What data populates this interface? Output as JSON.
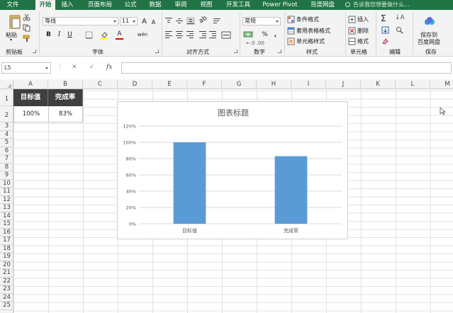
{
  "ribbon": {
    "tabs": [
      "文件",
      "开始",
      "插入",
      "页面布局",
      "公式",
      "数据",
      "审阅",
      "视图",
      "开发工具",
      "Power Pivot",
      "百度网盘"
    ],
    "active_tab": "开始",
    "tell_me": "告诉我您想要做什么...",
    "clipboard": {
      "paste": "粘贴",
      "label": "剪贴板"
    },
    "font": {
      "name": "等线",
      "size": "11",
      "bold": "B",
      "italic": "I",
      "underline": "U",
      "grow": "A",
      "shrink": "A",
      "font_color": "A",
      "phonetic": "wén",
      "label": "字体"
    },
    "alignment": {
      "label": "对齐方式"
    },
    "number": {
      "format": "常规",
      "percent": "%",
      "comma": ",",
      "label": "数字"
    },
    "styles": {
      "conditional": "条件格式",
      "table": "套用表格格式",
      "cell": "单元格样式",
      "label": "样式"
    },
    "cells": {
      "insert": "插入",
      "delete": "删除",
      "format": "格式",
      "label": "单元格"
    },
    "editing": {
      "label": "编辑"
    },
    "save": {
      "button": "保存到百度网盘",
      "line1": "保存到",
      "line2": "百度网盘",
      "label": "保存"
    }
  },
  "formula_bar": {
    "name_box": "L5",
    "cancel": "✕",
    "enter": "✓",
    "fx": "fx",
    "value": ""
  },
  "grid": {
    "columns": [
      "A",
      "B",
      "C",
      "D",
      "E",
      "F",
      "G",
      "H",
      "I",
      "J",
      "K",
      "L",
      "M"
    ],
    "rows": [
      "1",
      "2",
      "3",
      "4",
      "5",
      "6",
      "7",
      "8",
      "9",
      "10",
      "11",
      "12",
      "13",
      "14",
      "15",
      "16",
      "17",
      "18",
      "19",
      "20",
      "21",
      "22",
      "23",
      "24",
      "25"
    ]
  },
  "table": {
    "headers": [
      "目标值",
      "完成率"
    ],
    "values": [
      "100%",
      "83%"
    ]
  },
  "chart_data": {
    "type": "bar",
    "title": "图表标题",
    "categories": [
      "目标值",
      "完成率"
    ],
    "values": [
      100,
      83
    ],
    "ylim": [
      0,
      120
    ],
    "yticks": [
      "0%",
      "20%",
      "40%",
      "60%",
      "80%",
      "100%",
      "120%"
    ],
    "grid": true,
    "bar_color": "#5b9bd5"
  },
  "colors": {
    "accent": "#217346",
    "header_fill": "#3f3f3f"
  }
}
